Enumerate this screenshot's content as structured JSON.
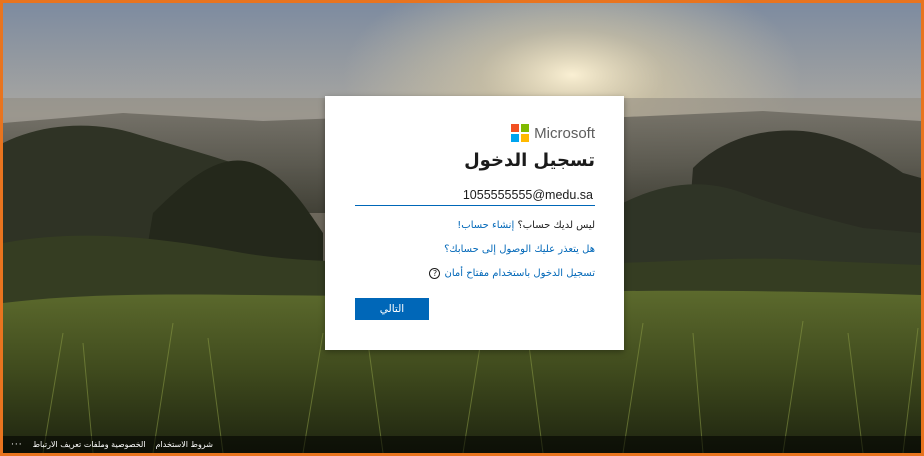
{
  "brand": {
    "name": "Microsoft",
    "colors": [
      "#f25022",
      "#7fba00",
      "#00a4ef",
      "#ffb900"
    ]
  },
  "signin": {
    "title": "تسجيل الدخول",
    "email_value": "1055555555@medu.sa",
    "no_account_text": "ليس لديك حساب؟",
    "create_account_link": "إنشاء حساب!",
    "cant_access_link": "هل يتعذر عليك الوصول إلى حسابك؟",
    "security_key_link": "تسجيل الدخول باستخدام مفتاح أمان",
    "help_icon": "?",
    "next_button": "التالي"
  },
  "footer": {
    "more": "···",
    "privacy_cookies": "الخصوصية وملفات تعريف الارتباط",
    "terms": "شروط الاستخدام"
  },
  "colors": {
    "frame_border": "#e8741f",
    "accent": "#0067b8"
  }
}
